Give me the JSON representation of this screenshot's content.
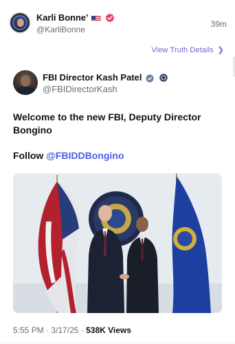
{
  "post": {
    "author_name": "Karli Bonne’",
    "author_handle": "@KarliBonne",
    "time": "39m",
    "view_details": "View Truth Details"
  },
  "quoted": {
    "author_name": "FBI Director Kash Patel",
    "author_handle": "@FBIDirectorKash",
    "text_line1": "Welcome to the new FBI, Deputy Director Bongino",
    "follow_prefix": "Follow ",
    "follow_mention": "@FBIDDBongino"
  },
  "footer": {
    "time": "5:55 PM",
    "sep1": " · ",
    "date": "3/17/25",
    "sep2": " · ",
    "views_count": "538K",
    "views_label": " Views"
  },
  "icons": {
    "flag": "us-flag-icon",
    "verified": "verified-badge-icon",
    "seal": "fbi-seal-icon",
    "chevron": "chevron-right-icon"
  },
  "colors": {
    "accent_link": "#7c5cd6",
    "mention": "#4a5ee8",
    "verified_badge": "#e8405f",
    "muted_text": "#6b6b75"
  }
}
